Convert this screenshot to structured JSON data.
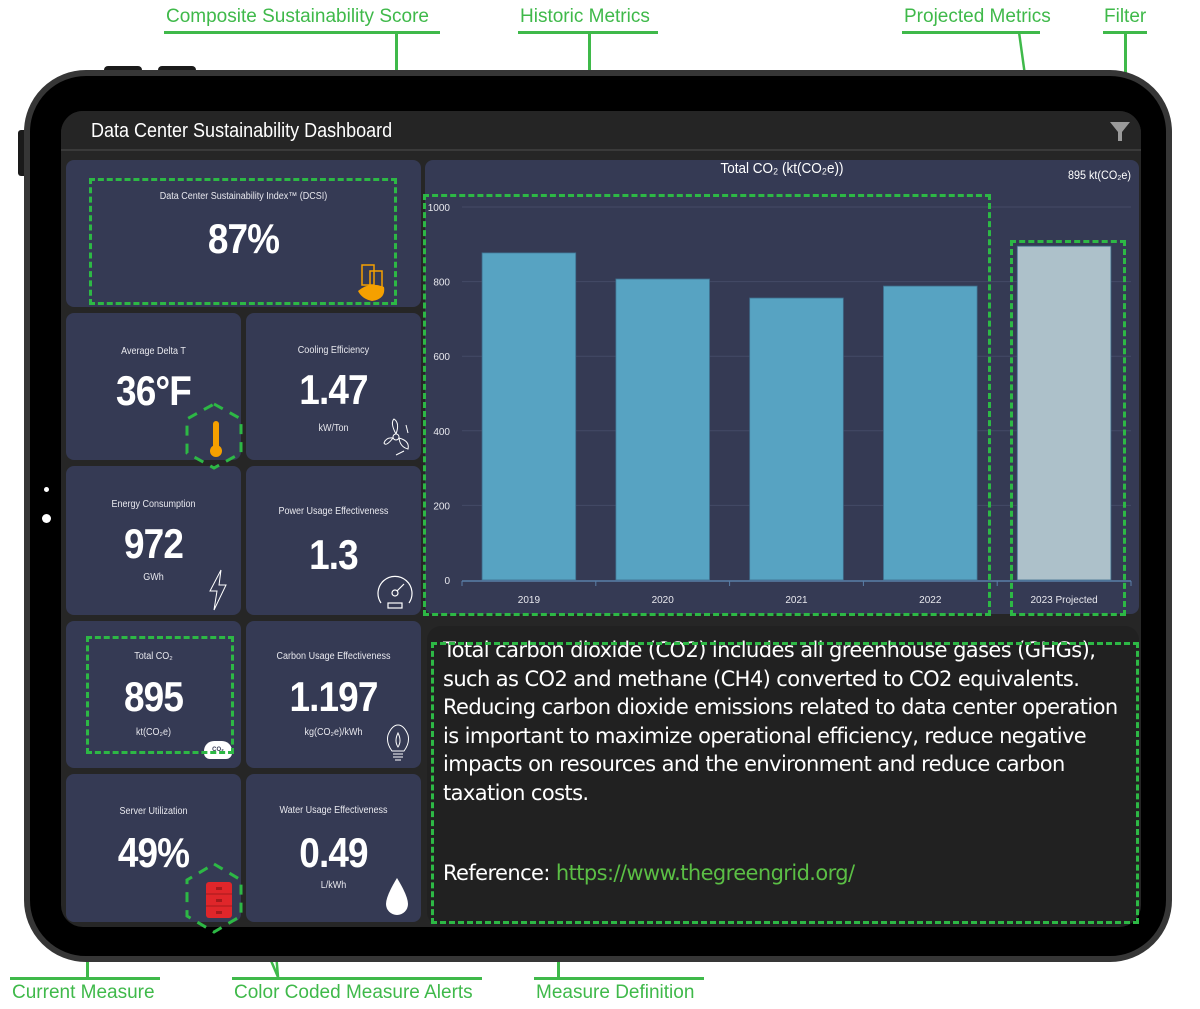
{
  "annotations": {
    "composite_score": "Composite Sustainability Score",
    "historic_metrics": "Historic Metrics",
    "projected_metrics": "Projected Metrics",
    "filter": "Filter",
    "current_measure": "Current Measure",
    "color_coded_alerts": "Color Coded Measure Alerts",
    "measure_definition": "Measure Definition"
  },
  "header": {
    "title": "Data Center Sustainability Dashboard",
    "filter_icon": "filter-funnel-icon"
  },
  "dcsi": {
    "label": "Data Center Sustainability Index™ (DCSI)",
    "value": "87%",
    "icon": "leaf-building-icon",
    "icon_color": "#f5a000"
  },
  "metrics": [
    {
      "id": "average-delta-t",
      "label": "Average Delta T",
      "value": "36°F",
      "unit": "",
      "icon": "thermometer-icon",
      "alert_color": "#f5a000"
    },
    {
      "id": "cooling-efficiency",
      "label": "Cooling Efficiency",
      "value": "1.47",
      "unit": "kW/Ton",
      "icon": "fan-icon"
    },
    {
      "id": "energy-consumption",
      "label": "Energy Consumption",
      "value": "972",
      "unit": "GWh",
      "icon": "lightning-icon"
    },
    {
      "id": "power-usage-effectiveness",
      "label": "Power Usage Effectiveness",
      "value": "1.3",
      "unit": "",
      "icon": "speedometer-icon"
    },
    {
      "id": "total-co2",
      "label": "Total CO₂",
      "value": "895",
      "unit": "kt(CO₂e)",
      "icon": "co2-cloud-icon",
      "icon_text": "CO₂"
    },
    {
      "id": "carbon-usage-effectiveness",
      "label": "Carbon Usage Effectiveness",
      "value": "1.197",
      "unit": "kg(CO₂e)/kWh",
      "icon": "lightbulb-flame-icon"
    },
    {
      "id": "server-utilization",
      "label": "Server Utilization",
      "value": "49%",
      "unit": "",
      "icon": "server-rack-icon",
      "alert_color": "#e0262a"
    },
    {
      "id": "water-usage-effectiveness",
      "label": "Water Usage Effectiveness",
      "value": "0.49",
      "unit": "L/kWh",
      "icon": "water-drop-icon"
    }
  ],
  "chart_data": {
    "type": "bar",
    "title": "Total CO₂ (kt(CO₂e))",
    "readout": "895 kt(CO₂e)",
    "categories": [
      "2019",
      "2020",
      "2021",
      "2022",
      "2023 Projected"
    ],
    "values": [
      877,
      807,
      756,
      788,
      895
    ],
    "projected": [
      false,
      false,
      false,
      false,
      true
    ],
    "colors": {
      "historic": "#57a3c2",
      "projected": "#adc1ca"
    },
    "yticks": [
      0,
      200,
      400,
      600,
      800,
      1000
    ],
    "ylim": [
      0,
      1000
    ],
    "xlabel": "",
    "ylabel": "",
    "grid": true
  },
  "definition": {
    "text": "Total carbon dioxide (CO2) includes all greenhouse gases (GHGs), such as CO2 and methane (CH4) converted to CO2 equivalents. Reducing carbon dioxide emissions related to data center operation is important to maximize operational efficiency, reduce negative impacts on resources and the environment and reduce carbon taxation costs.",
    "reference_label": "Reference:",
    "reference_link": "https://www.thegreengrid.org/"
  }
}
